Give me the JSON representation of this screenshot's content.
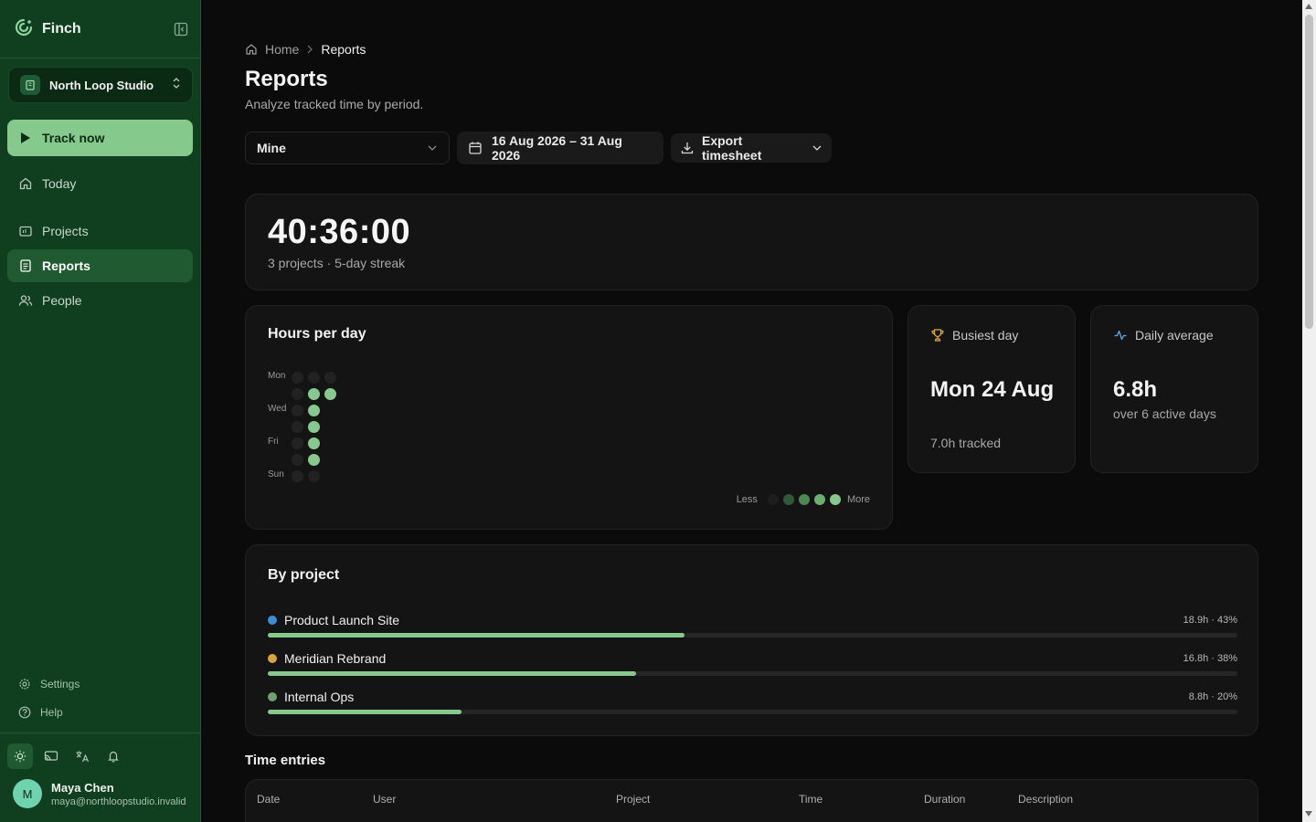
{
  "app": {
    "name": "Finch"
  },
  "sidebar": {
    "workspace": "North Loop Studio",
    "track_label": "Track now",
    "nav": [
      {
        "label": "Today",
        "icon": "home-icon"
      },
      {
        "label": "Projects",
        "icon": "folder-icon"
      },
      {
        "label": "Reports",
        "icon": "document-icon",
        "active": true
      },
      {
        "label": "People",
        "icon": "users-icon"
      }
    ],
    "footer": [
      {
        "label": "Settings",
        "icon": "gear-icon"
      },
      {
        "label": "Help",
        "icon": "help-icon"
      }
    ],
    "tools": [
      "sun-icon",
      "cast-icon",
      "translate-icon",
      "bell-icon"
    ],
    "user": {
      "initial": "M",
      "name": "Maya Chen",
      "email": "maya@northloopstudio.invalid"
    }
  },
  "breadcrumb": {
    "home": "Home",
    "current": "Reports"
  },
  "page": {
    "title": "Reports",
    "subtitle": "Analyze tracked time by period."
  },
  "filters": {
    "scope": "Mine",
    "date_range": "16 Aug 2026 – 31 Aug 2026",
    "export_label": "Export timesheet"
  },
  "summary": {
    "total": "40:36:00",
    "meta": "3 projects · 5-day streak"
  },
  "hours_per_day": {
    "title": "Hours per day",
    "day_labels": [
      "Mon",
      "",
      "Wed",
      "",
      "Fri",
      "",
      "Sun"
    ],
    "weeks": [
      [
        0,
        0,
        0,
        0,
        0,
        0,
        0
      ],
      [
        0,
        4,
        4,
        4,
        4,
        4,
        0
      ],
      [
        0,
        4,
        null,
        null,
        null,
        null,
        null
      ]
    ],
    "legend_less": "Less",
    "legend_more": "More"
  },
  "stats": {
    "busiest": {
      "label": "Busiest day",
      "value": "Mon 24 Aug",
      "sub": "7.0h tracked"
    },
    "average": {
      "label": "Daily average",
      "value": "6.8h",
      "sub": "over 6 active days"
    }
  },
  "projects": {
    "title": "By project",
    "items": [
      {
        "name": "Product Launch Site",
        "stat": "18.9h · 43%",
        "fraction": 0.43,
        "color": "#3b8fd6"
      },
      {
        "name": "Meridian Rebrand",
        "stat": "16.8h · 38%",
        "fraction": 0.38,
        "color": "#d9a43e"
      },
      {
        "name": "Internal Ops",
        "stat": "8.8h · 20%",
        "fraction": 0.2,
        "color": "#6fa071"
      }
    ]
  },
  "time_entries": {
    "title": "Time entries",
    "columns": [
      "Date",
      "User",
      "Project",
      "Time",
      "Duration",
      "Description"
    ]
  },
  "colors": {
    "accent": "#86c98c",
    "sidebar": "#0f3f1f",
    "heat_levels": [
      "#2a2a2a",
      "#2f5a35",
      "#4b8a52",
      "#6aae71",
      "#86c98c"
    ]
  }
}
